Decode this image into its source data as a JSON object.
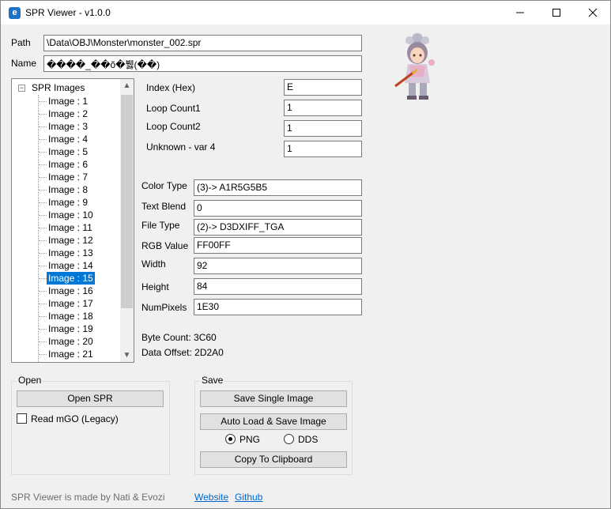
{
  "window": {
    "title": "SPR Viewer - v1.0.0",
    "icon_letter": "e"
  },
  "path": {
    "label": "Path",
    "value": "\\Data\\OBJ\\Monster\\monster_002.spr"
  },
  "name": {
    "label": "Name",
    "value": "����_��õ�뷇(��)"
  },
  "tree": {
    "root_label": "SPR Images",
    "items": [
      "Image : 1",
      "Image : 2",
      "Image : 3",
      "Image : 4",
      "Image : 5",
      "Image : 6",
      "Image : 7",
      "Image : 8",
      "Image : 9",
      "Image : 10",
      "Image : 11",
      "Image : 12",
      "Image : 13",
      "Image : 14",
      "Image : 15",
      "Image : 16",
      "Image : 17",
      "Image : 18",
      "Image : 19",
      "Image : 20",
      "Image : 21"
    ],
    "selected": "Image : 15"
  },
  "header_fields": {
    "index_hex": {
      "label": "Index (Hex)",
      "value": "E"
    },
    "loop_count1": {
      "label": "Loop Count1",
      "value": "1"
    },
    "loop_count2": {
      "label": "Loop Count2",
      "value": "1"
    },
    "unknown_var4": {
      "label": "Unknown - var 4",
      "value": "1"
    }
  },
  "image_fields": {
    "color_type": {
      "label": "Color Type",
      "value": "(3)-> A1R5G5B5"
    },
    "text_blend": {
      "label": "Text Blend",
      "value": "0"
    },
    "file_type": {
      "label": "File Type",
      "value": "(2)-> D3DXIFF_TGA"
    },
    "rgb_value": {
      "label": "RGB Value",
      "value": "FF00FF"
    },
    "width": {
      "label": "Width",
      "value": "92"
    },
    "height": {
      "label": "Height",
      "value": "84"
    },
    "num_pixels": {
      "label": "NumPixels",
      "value": "1E30"
    }
  },
  "info": {
    "byte_count": "Byte Count: 3C60",
    "data_offset": "Data Offset: 2D2A0"
  },
  "open_group": {
    "title": "Open",
    "open_button": "Open SPR",
    "read_mgo_label": "Read mGO (Legacy)",
    "read_mgo_checked": false
  },
  "save_group": {
    "title": "Save",
    "save_single": "Save Single Image",
    "auto_load_save": "Auto Load & Save Image",
    "format_png": "PNG",
    "format_dds": "DDS",
    "selected_format": "PNG",
    "copy_clipboard": "Copy To Clipboard"
  },
  "footer": {
    "credit": "SPR Viewer is made by Nati & Evozi",
    "website": "Website",
    "github": "Github"
  },
  "icons": [
    "app-icon",
    "minimize-icon",
    "maximize-icon",
    "close-icon",
    "scroll-up-icon",
    "scroll-down-icon",
    "tree-collapse-icon",
    "sprite-preview"
  ]
}
